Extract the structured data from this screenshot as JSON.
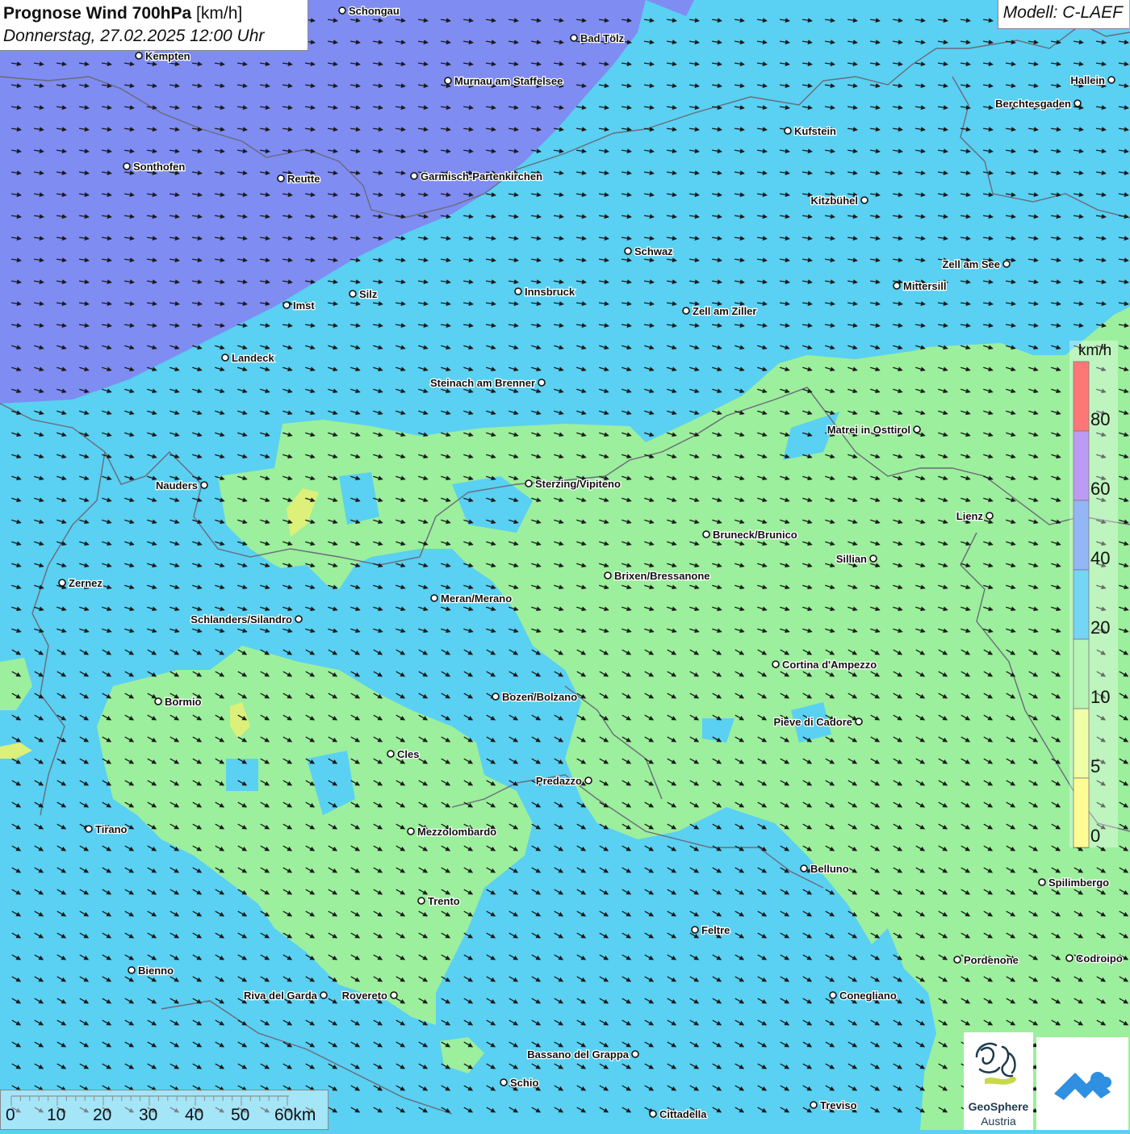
{
  "header": {
    "title_main": "Prognose Wind 700hPa",
    "title_unit": " [km/h]",
    "subtitle": "Donnerstag, 27.02.2025 12:00 Uhr"
  },
  "model": {
    "label": "Modell: C-LAEF"
  },
  "legend": {
    "unit": "km/h",
    "labels": [
      "80",
      "60",
      "40",
      "20",
      "10",
      "5",
      "0"
    ],
    "colors": [
      "#ff2d2d",
      "#9966ee",
      "#5b8ff0",
      "#2bbff0",
      "#8ef08e",
      "#e6ff7a",
      "#fffa5a"
    ]
  },
  "scalebar": {
    "labels": [
      "0",
      "10",
      "20",
      "30",
      "40",
      "50",
      "60km"
    ]
  },
  "logos": {
    "geosphere_name": "GeoSphere",
    "geosphere_country": "Austria"
  },
  "field_colors": {
    "violet_region": "#7f8cf2",
    "blue_region": "#5ad0f2",
    "green_region": "#9cef9c",
    "yellow_spots": "#dcf07a",
    "border_color": "#6a6a7a",
    "arrow_color": "#1a1a1a"
  },
  "places": [
    {
      "name": "Schongau"
    },
    {
      "name": "Kempten"
    },
    {
      "name": "Bad Tölz"
    },
    {
      "name": "Murnau am Staffelsee"
    },
    {
      "name": "Hallein"
    },
    {
      "name": "Berchtesgaden"
    },
    {
      "name": "Kufstein"
    },
    {
      "name": "Sonthofen"
    },
    {
      "name": "Reutte"
    },
    {
      "name": "Garmisch-Partenkirchen"
    },
    {
      "name": "Kitzbühel"
    },
    {
      "name": "Schwaz"
    },
    {
      "name": "Zell am See"
    },
    {
      "name": "Mittersill"
    },
    {
      "name": "Innsbruck"
    },
    {
      "name": "Imst"
    },
    {
      "name": "Silz"
    },
    {
      "name": "Zell am Ziller"
    },
    {
      "name": "Landeck"
    },
    {
      "name": "Steinach am Brenner"
    },
    {
      "name": "Matrei in Osttirol"
    },
    {
      "name": "Nauders"
    },
    {
      "name": "Sterzing/Vipiteno"
    },
    {
      "name": "Lienz"
    },
    {
      "name": "Bruneck/Brunico"
    },
    {
      "name": "Sillian"
    },
    {
      "name": "Brixen/Bressanone"
    },
    {
      "name": "Zernez"
    },
    {
      "name": "Meran/Merano"
    },
    {
      "name": "Schlanders/Silandro"
    },
    {
      "name": "Cortina d'Ampezzo"
    },
    {
      "name": "Bozen/Bolzano"
    },
    {
      "name": "Bormio"
    },
    {
      "name": "Pieve di Cadore"
    },
    {
      "name": "Cles"
    },
    {
      "name": "Predazzo"
    },
    {
      "name": "Tirano"
    },
    {
      "name": "Mezzolombardo"
    },
    {
      "name": "Belluno"
    },
    {
      "name": "Spilimbergo"
    },
    {
      "name": "Trento"
    },
    {
      "name": "Feltre"
    },
    {
      "name": "Pordenone"
    },
    {
      "name": "Codroipo"
    },
    {
      "name": "Bienno"
    },
    {
      "name": "Riva del Garda"
    },
    {
      "name": "Rovereto"
    },
    {
      "name": "Conegliano"
    },
    {
      "name": "Bassano del Grappa"
    },
    {
      "name": "Schio"
    },
    {
      "name": "Treviso"
    },
    {
      "name": "Cittadella"
    }
  ]
}
